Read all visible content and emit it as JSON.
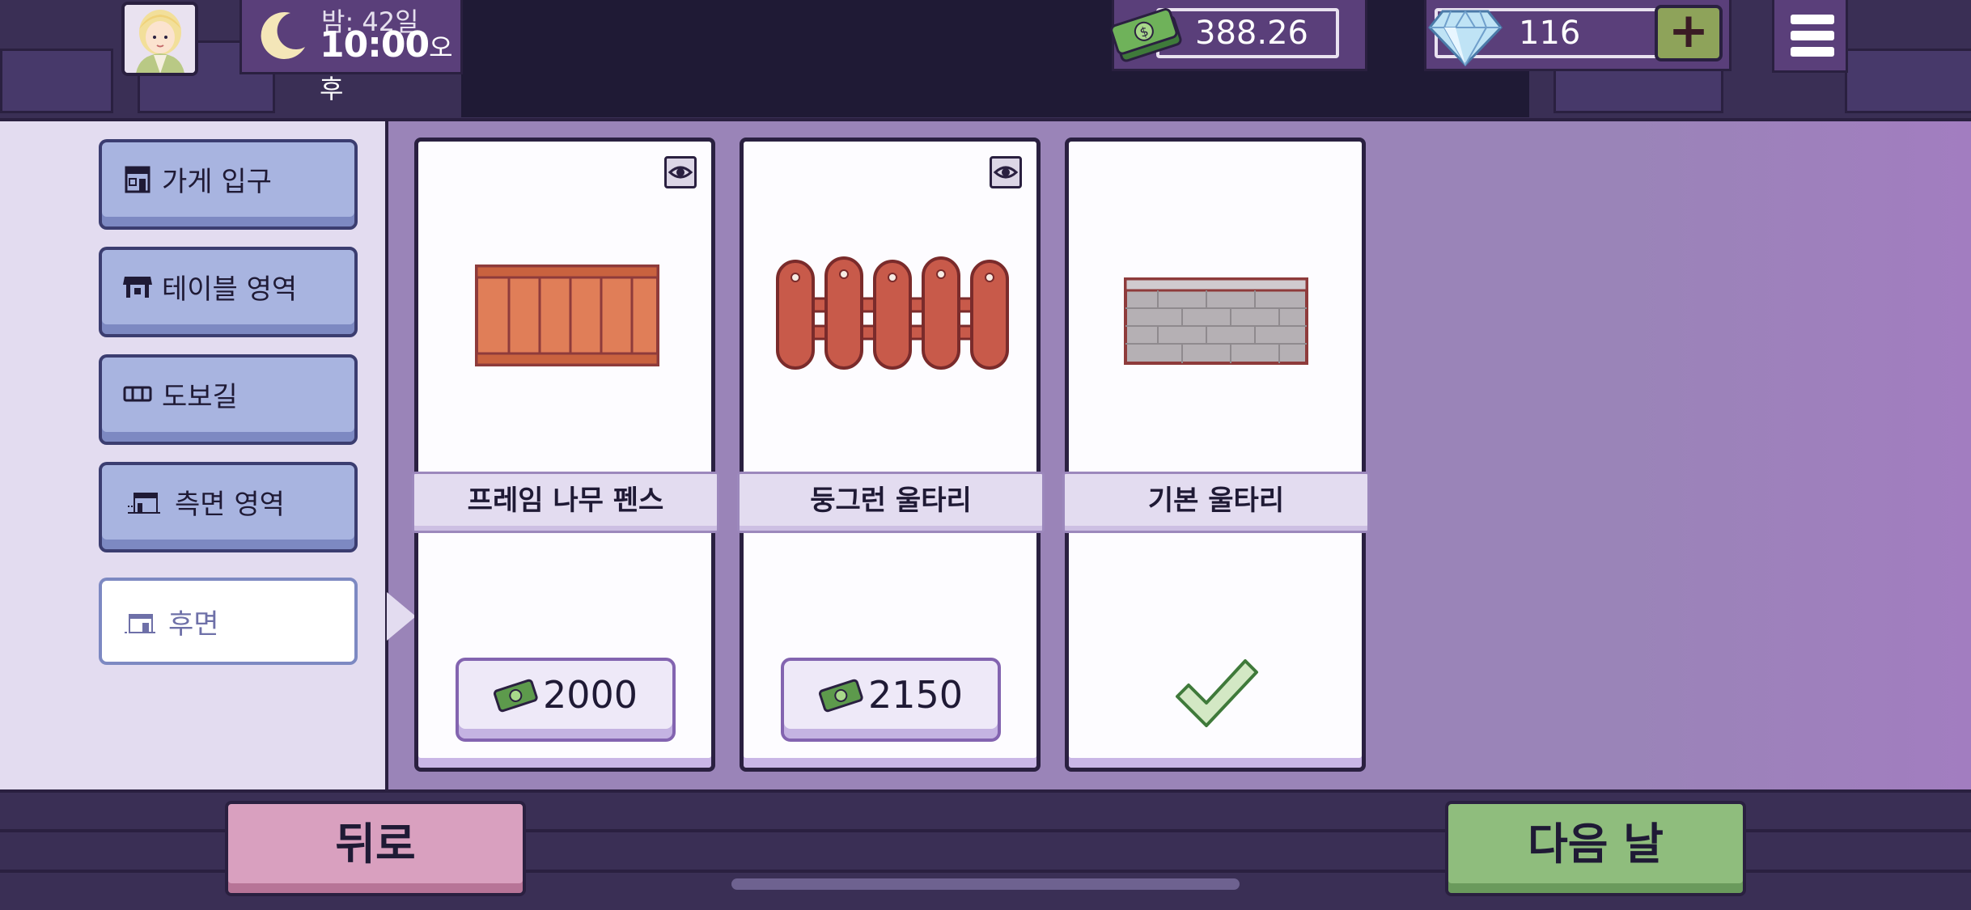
{
  "hud": {
    "day_label": "밤: 42일",
    "time": "10:00",
    "ampm": "오후",
    "money": "388.26",
    "gems": "116",
    "plus_label": "+"
  },
  "categories": [
    {
      "label": "가게 입구",
      "icon": "storefront-icon",
      "selected": false
    },
    {
      "label": "테이블 영역",
      "icon": "table-icon",
      "selected": false
    },
    {
      "label": "도보길",
      "icon": "walkway-icon",
      "selected": false
    },
    {
      "label": "측면 영역",
      "icon": "side-area-icon",
      "selected": false
    },
    {
      "label": "후면",
      "icon": "back-area-icon",
      "selected": true
    }
  ],
  "items": [
    {
      "name": "프레임 나무 펜스",
      "price": "2000",
      "owned": false,
      "preview": true
    },
    {
      "name": "둥그런 울타리",
      "price": "2150",
      "owned": false,
      "preview": true
    },
    {
      "name": "기본 울타리",
      "price": "",
      "owned": true,
      "preview": false
    }
  ],
  "buttons": {
    "back": "뒤로",
    "next_day": "다음 날"
  },
  "colors": {
    "panel_bg": "#9a84b8",
    "category_btn": "#a8b4e0",
    "back_btn": "#d9a0bf",
    "next_btn": "#8fbd7d",
    "plus_btn": "#8ea35a"
  }
}
